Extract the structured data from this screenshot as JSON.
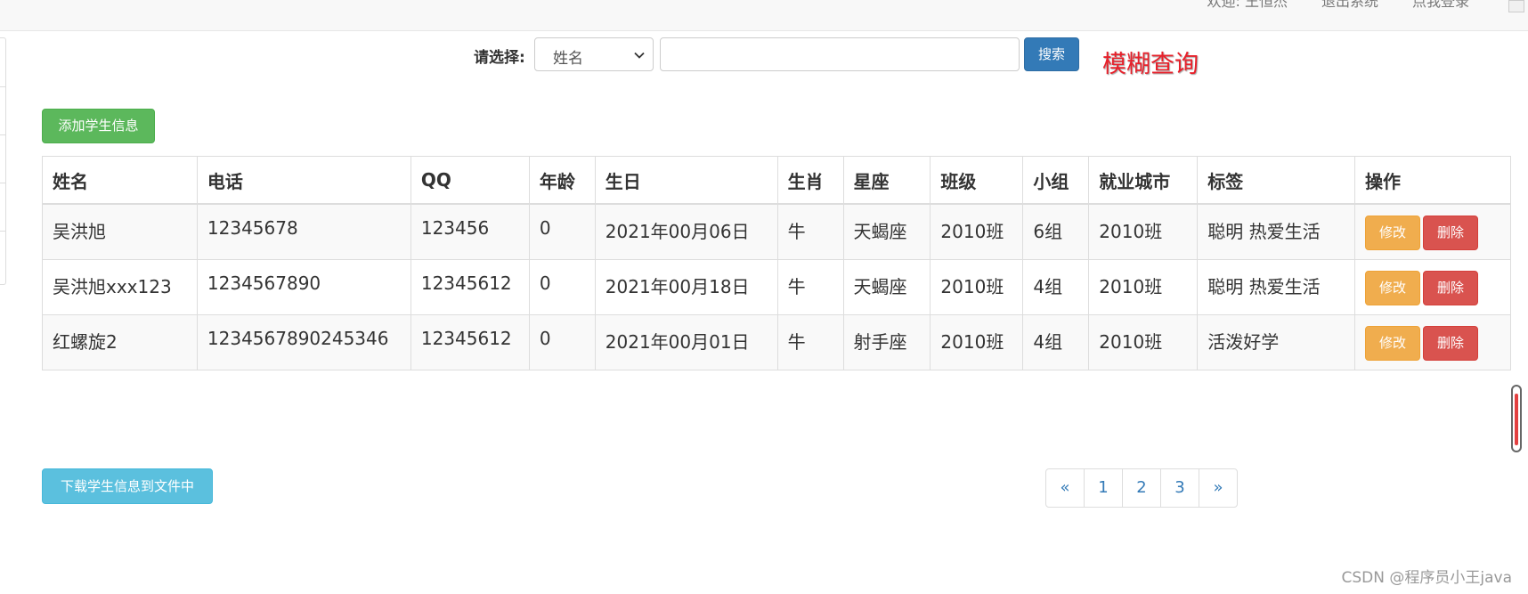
{
  "header": {
    "links": [
      "欢迎: 王恒杰",
      "退出系统",
      "点我登录"
    ]
  },
  "search": {
    "label": "请选择:",
    "select_value": "姓名",
    "input_value": "",
    "button_label": "搜索",
    "note": "模糊查询"
  },
  "actions": {
    "add_label": "添加学生信息",
    "download_label": "下载学生信息到文件中"
  },
  "table": {
    "headers": [
      "姓名",
      "电话",
      "QQ",
      "年龄",
      "生日",
      "生肖",
      "星座",
      "班级",
      "小组",
      "就业城市",
      "标签",
      "操作"
    ],
    "rows": [
      [
        "吴洪旭",
        "12345678",
        "123456",
        "0",
        "2021年00月06日",
        "牛",
        "天蝎座",
        "2010班",
        "6组",
        "2010班",
        "聪明 热爱生活"
      ],
      [
        "吴洪旭xxx123",
        "1234567890",
        "12345612",
        "0",
        "2021年00月18日",
        "牛",
        "天蝎座",
        "2010班",
        "4组",
        "2010班",
        "聪明 热爱生活"
      ],
      [
        "红螺旋2",
        "1234567890245346",
        "12345612",
        "0",
        "2021年00月01日",
        "牛",
        "射手座",
        "2010班",
        "4组",
        "2010班",
        "活泼好学"
      ]
    ],
    "edit_label": "修改",
    "delete_label": "删除"
  },
  "pagination": {
    "prev": "«",
    "pages": [
      "1",
      "2",
      "3"
    ],
    "next": "»"
  },
  "watermark": "CSDN @程序员小王java",
  "colors": {
    "primary": "#337ab7",
    "success": "#5cb85c",
    "info": "#5bc0de",
    "warning": "#f0ad4e",
    "danger": "#d9534f",
    "note_red": "#e8202a"
  }
}
